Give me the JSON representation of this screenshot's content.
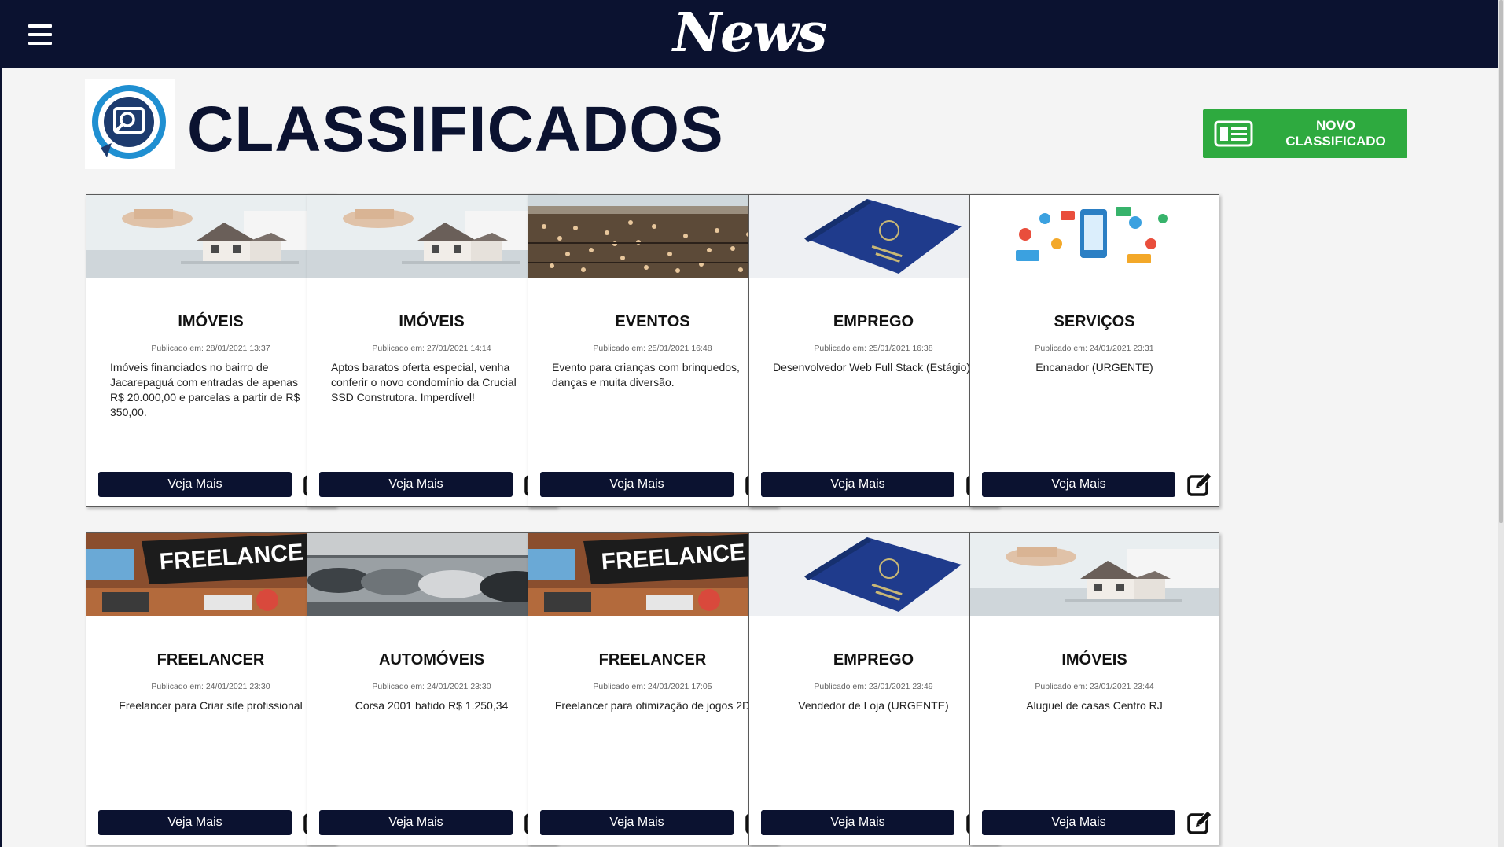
{
  "app": {
    "logo": "News"
  },
  "page": {
    "title": "CLASSIFICADOS",
    "new_button_label": "NOVO CLASSIFICADO"
  },
  "colors": {
    "navy": "#0b1230",
    "green": "#2eaa3f"
  },
  "cards": [
    {
      "category": "IMÓVEIS",
      "date": "Publicado em: 28/01/2021 13:37",
      "description": "Imóveis financiados no bairro de Jacarepaguá com entradas de apenas R$ 20.000,00 e parcelas a partir de R$ 350,00.",
      "image": "house-image",
      "button": "Veja Mais"
    },
    {
      "category": "IMÓVEIS",
      "date": "Publicado em: 27/01/2021 14:14",
      "description": "Aptos baratos oferta especial, venha conferir o novo condomínio da Crucial SSD Construtora. Imperdível!",
      "image": "house-image",
      "button": "Veja Mais"
    },
    {
      "category": "EVENTOS",
      "date": "Publicado em: 25/01/2021 16:48",
      "description": "Evento para crianças com brinquedos, danças e muita diversão.",
      "image": "crowd-image",
      "button": "Veja Mais"
    },
    {
      "category": "EMPREGO",
      "date": "Publicado em: 25/01/2021 16:38",
      "description": "Desenvolvedor Web Full Stack (Estágio).",
      "image": "work-card-image",
      "button": "Veja Mais"
    },
    {
      "category": "SERVIÇOS",
      "date": "Publicado em: 24/01/2021 23:31",
      "description": "Encanador (URGENTE)",
      "image": "services-icons-image",
      "button": "Veja Mais"
    },
    {
      "category": "FREELANCER",
      "date": "Publicado em: 24/01/2021 23:30",
      "description": "Freelancer para Criar site profissional",
      "image": "freelance-image",
      "button": "Veja Mais"
    },
    {
      "category": "AUTOMÓVEIS",
      "date": "Publicado em: 24/01/2021 23:30",
      "description": "Corsa 2001 batido R$ 1.250,34",
      "image": "cars-image",
      "button": "Veja Mais"
    },
    {
      "category": "FREELANCER",
      "date": "Publicado em: 24/01/2021 17:05",
      "description": "Freelancer para otimização de jogos 2D",
      "image": "freelance-image",
      "button": "Veja Mais"
    },
    {
      "category": "EMPREGO",
      "date": "Publicado em: 23/01/2021 23:49",
      "description": "Vendedor de Loja (URGENTE)",
      "image": "work-card-image",
      "button": "Veja Mais"
    },
    {
      "category": "IMÓVEIS",
      "date": "Publicado em: 23/01/2021 23:44",
      "description": "Aluguel de casas Centro RJ",
      "image": "house-image",
      "button": "Veja Mais"
    }
  ]
}
